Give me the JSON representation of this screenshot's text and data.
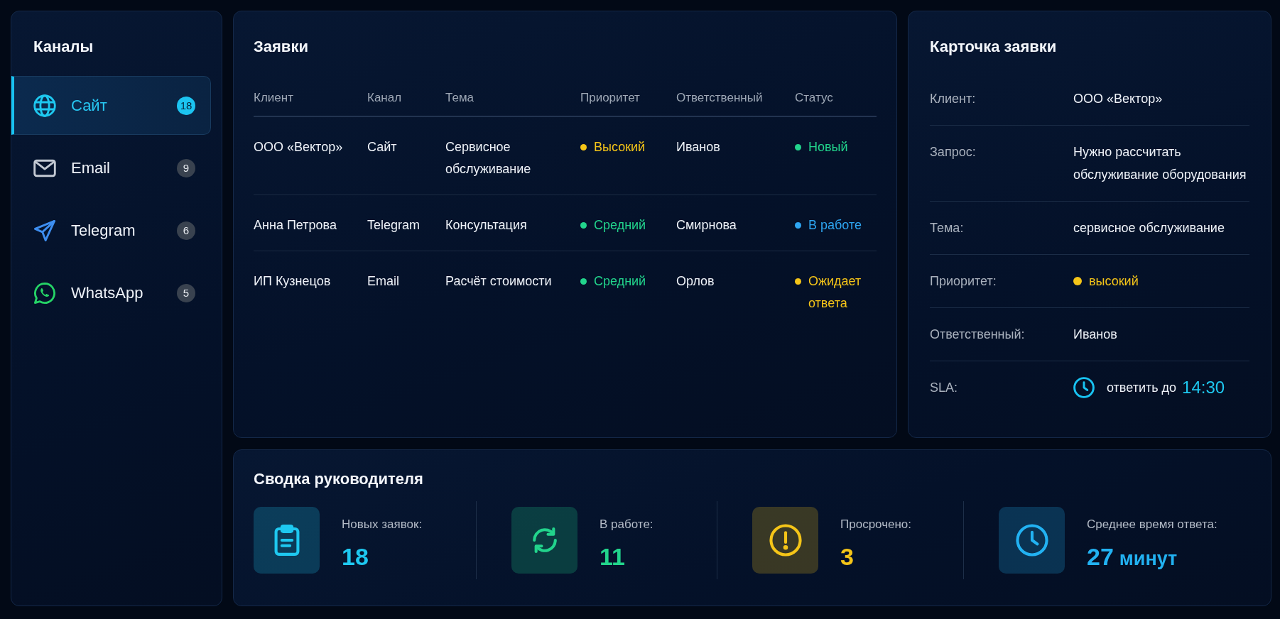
{
  "sidebar": {
    "title": "Каналы",
    "channels": [
      {
        "kind": "globe",
        "label": "Сайт",
        "count": "18",
        "color": "#1ec8f0",
        "selected": true
      },
      {
        "kind": "envelope",
        "label": "Email",
        "count": "9",
        "color": "#c3c9d3",
        "selected": false
      },
      {
        "kind": "plane",
        "label": "Telegram",
        "count": "6",
        "color": "#3d8ef0",
        "selected": false
      },
      {
        "kind": "chat",
        "label": "WhatsApp",
        "count": "5",
        "color": "#25d366",
        "selected": false
      }
    ]
  },
  "requests": {
    "title": "Заявки",
    "columns": [
      "Клиент",
      "Канал",
      "Тема",
      "Приоритет",
      "Ответственный",
      "Статус"
    ],
    "rows": [
      {
        "client": "ООО «Вектор»",
        "channel": "Сайт",
        "topic": "Сервисное обслуживание",
        "priority": {
          "text": "Высокий",
          "color": "#f5c518"
        },
        "assignee": "Иванов",
        "status": {
          "text": "Новый",
          "color": "#22d48c"
        }
      },
      {
        "client": "Анна Петрова",
        "channel": "Telegram",
        "topic": "Консультация",
        "priority": {
          "text": "Средний",
          "color": "#22d48c"
        },
        "assignee": "Смирнова",
        "status": {
          "text": "В работе",
          "color": "#2ea6f2"
        }
      },
      {
        "client": "ИП Кузнецов",
        "channel": "Email",
        "topic": "Расчёт стоимости",
        "priority": {
          "text": "Средний",
          "color": "#22d48c"
        },
        "assignee": "Орлов",
        "status": {
          "text": "Ожидает ответа",
          "color": "#f5c518"
        }
      }
    ]
  },
  "ticket_card": {
    "title": "Карточка заявки",
    "fields": [
      {
        "kind": "text",
        "label": "Клиент:",
        "value": "ООО «Вектор»"
      },
      {
        "kind": "text",
        "label": "Запрос:",
        "value": "Нужно рассчитать обслуживание оборудования"
      },
      {
        "kind": "text",
        "label": "Тема:",
        "value": "сервисное обслуживание"
      },
      {
        "kind": "priority",
        "label": "Приоритет:",
        "value": "высокий",
        "color": "#f5c518"
      },
      {
        "kind": "text",
        "label": "Ответственный:",
        "value": "Иванов"
      },
      {
        "kind": "sla",
        "label": "SLA:",
        "value": "ответить до",
        "time": "14:30"
      }
    ]
  },
  "summary": {
    "title": "Сводка руководителя",
    "stats": [
      {
        "kind": "clipboard",
        "label": "Новых заявок:",
        "value": "18",
        "color": "#1ec8f0"
      },
      {
        "kind": "refresh",
        "label": "В работе:",
        "value": "11",
        "color": "#22d48c"
      },
      {
        "kind": "alert",
        "label": "Просрочено:",
        "value": "3",
        "color": "#f5c518"
      },
      {
        "kind": "clock",
        "label": "Среднее время ответа:",
        "value": "27",
        "unit": "минут",
        "color": "#22b2f2"
      }
    ]
  }
}
